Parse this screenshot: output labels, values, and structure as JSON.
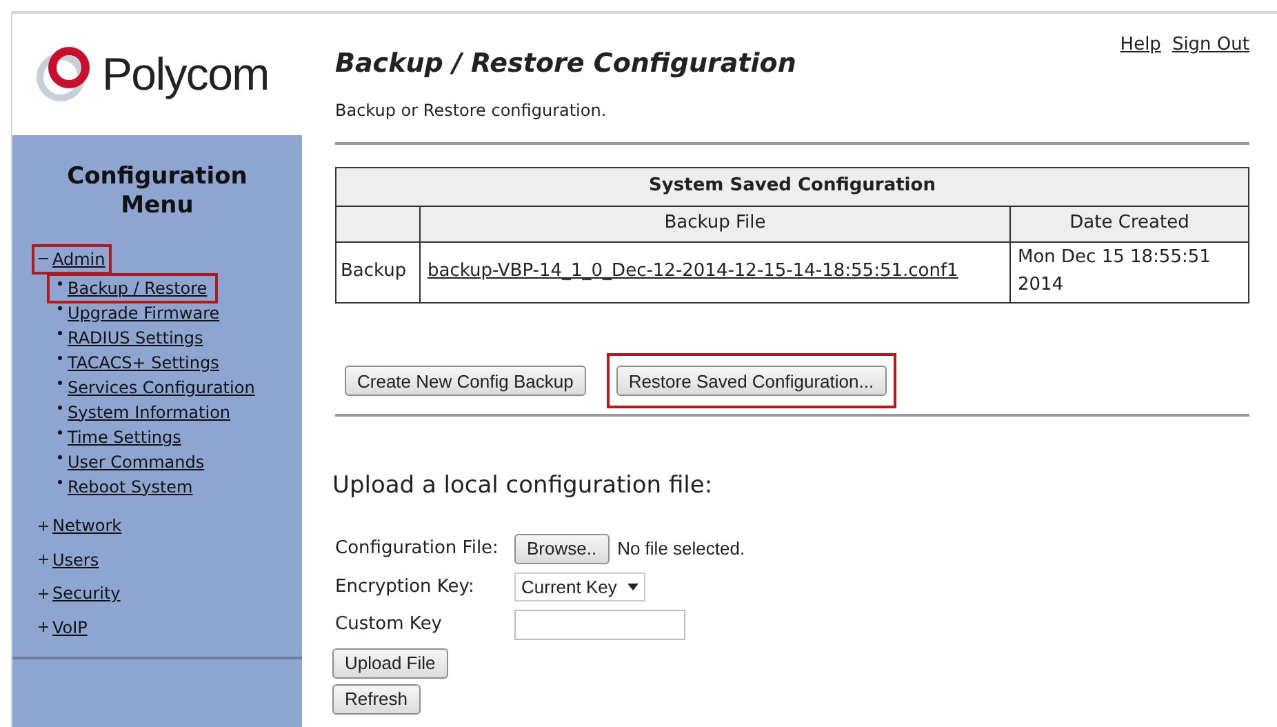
{
  "logo": {
    "text": "Polycom"
  },
  "sidebar": {
    "title": "Configuration Menu",
    "groups": [
      {
        "label": "Admin",
        "expanded": true,
        "highlighted": true,
        "children": [
          {
            "label": "Backup / Restore",
            "highlighted": true
          },
          {
            "label": "Upgrade Firmware",
            "highlighted": false
          },
          {
            "label": "RADIUS Settings",
            "highlighted": false
          },
          {
            "label": "TACACS+ Settings",
            "highlighted": false
          },
          {
            "label": "Services Configuration",
            "highlighted": false
          },
          {
            "label": "System Information",
            "highlighted": false
          },
          {
            "label": "Time Settings",
            "highlighted": false
          },
          {
            "label": "User Commands",
            "highlighted": false
          },
          {
            "label": "Reboot System",
            "highlighted": false
          }
        ]
      },
      {
        "label": "Network",
        "expanded": false,
        "highlighted": false
      },
      {
        "label": "Users",
        "expanded": false,
        "highlighted": false
      },
      {
        "label": "Security",
        "expanded": false,
        "highlighted": false
      },
      {
        "label": "VoIP",
        "expanded": false,
        "highlighted": false
      }
    ]
  },
  "header_links": [
    "Help",
    "Sign Out"
  ],
  "page": {
    "title": "Backup / Restore Configuration",
    "subtitle": "Backup or Restore configuration."
  },
  "table": {
    "caption": "System Saved Configuration",
    "columns": [
      "Backup File",
      "Date Created"
    ],
    "rows": [
      {
        "label": "Backup",
        "file": "backup-VBP-14_1_0_Dec-12-2014-12-15-14-18:55:51.conf1",
        "date": "Mon Dec 15 18:55:51 2014"
      }
    ]
  },
  "actions": [
    {
      "label": "Create New Config Backup",
      "highlighted": false
    },
    {
      "label": "Restore Saved Configuration...",
      "highlighted": true
    }
  ],
  "upload": {
    "heading": "Upload a local configuration file:",
    "file_label": "Configuration File:",
    "browse": "Browse..",
    "file_status": "No file selected.",
    "key_label": "Encryption Key:",
    "key_value": "Current Key",
    "custom_label": "Custom Key",
    "buttons": [
      "Upload File",
      "Refresh"
    ]
  }
}
